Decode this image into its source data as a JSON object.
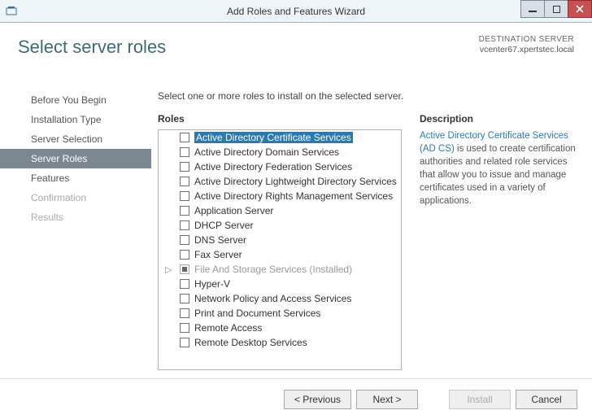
{
  "window": {
    "title": "Add Roles and Features Wizard"
  },
  "header": {
    "page_title": "Select server roles",
    "destination_label": "DESTINATION SERVER",
    "destination_host": "vcenter67.xpertstec.local"
  },
  "sidebar": {
    "steps": [
      {
        "label": "Before You Begin",
        "state": "done"
      },
      {
        "label": "Installation Type",
        "state": "done"
      },
      {
        "label": "Server Selection",
        "state": "done"
      },
      {
        "label": "Server Roles",
        "state": "active"
      },
      {
        "label": "Features",
        "state": "next"
      },
      {
        "label": "Confirmation",
        "state": "future"
      },
      {
        "label": "Results",
        "state": "future"
      }
    ]
  },
  "main": {
    "instruction": "Select one or more roles to install on the selected server.",
    "roles_header": "Roles",
    "description_header": "Description",
    "roles": [
      {
        "label": "Active Directory Certificate Services",
        "checked": false,
        "disabled": false,
        "selected": true
      },
      {
        "label": "Active Directory Domain Services",
        "checked": false,
        "disabled": false
      },
      {
        "label": "Active Directory Federation Services",
        "checked": false,
        "disabled": false
      },
      {
        "label": "Active Directory Lightweight Directory Services",
        "checked": false,
        "disabled": false
      },
      {
        "label": "Active Directory Rights Management Services",
        "checked": false,
        "disabled": false
      },
      {
        "label": "Application Server",
        "checked": false,
        "disabled": false
      },
      {
        "label": "DHCP Server",
        "checked": false,
        "disabled": false
      },
      {
        "label": "DNS Server",
        "checked": false,
        "disabled": false
      },
      {
        "label": "Fax Server",
        "checked": false,
        "disabled": false
      },
      {
        "label": "File And Storage Services (Installed)",
        "checked": true,
        "disabled": true,
        "expandable": true
      },
      {
        "label": "Hyper-V",
        "checked": false,
        "disabled": false
      },
      {
        "label": "Network Policy and Access Services",
        "checked": false,
        "disabled": false
      },
      {
        "label": "Print and Document Services",
        "checked": false,
        "disabled": false
      },
      {
        "label": "Remote Access",
        "checked": false,
        "disabled": false
      },
      {
        "label": "Remote Desktop Services",
        "checked": false,
        "disabled": false
      }
    ],
    "description": {
      "highlight": "Active Directory Certificate Services (AD CS)",
      "rest": " is used to create certification authorities and related role services that allow you to issue and manage certificates used in a variety of applications."
    }
  },
  "buttons": {
    "previous": "< Previous",
    "next": "Next >",
    "install": "Install",
    "cancel": "Cancel",
    "install_enabled": false
  }
}
